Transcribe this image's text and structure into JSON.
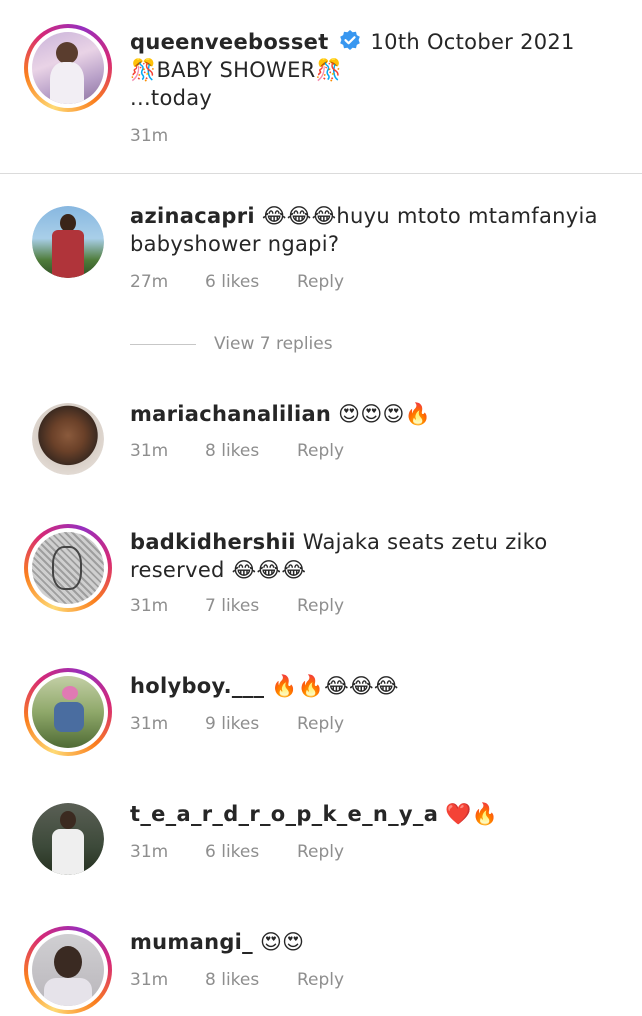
{
  "caption": {
    "username": "queenveebosset",
    "date": "10th October 2021",
    "line1": "🎊BABY SHOWER🎊",
    "line2": "...today",
    "time": "31m"
  },
  "comments": [
    {
      "username": "azinacapri",
      "text": "😂😂😂huyu mtoto mtamfanyia babyshower ngapi?",
      "time": "27m",
      "likes": "6 likes",
      "reply": "Reply"
    },
    {
      "username": "mariachanalilian",
      "text": "😍😍😍🔥",
      "time": "31m",
      "likes": "8 likes",
      "reply": "Reply"
    },
    {
      "username": "badkidhershii",
      "text": "Wajaka seats zetu ziko reserved 😂😂😂",
      "time": "31m",
      "likes": "7 likes",
      "reply": "Reply"
    },
    {
      "username": "holyboy.___",
      "text": "🔥🔥😂😂😂",
      "time": "31m",
      "likes": "9 likes",
      "reply": "Reply"
    },
    {
      "username": "t_e_a_r_d_r_o_p_k_e_n_y_a",
      "text": "❤️🔥",
      "time": "31m",
      "likes": "6 likes",
      "reply": "Reply"
    },
    {
      "username": "mumangi_",
      "text": "😍😍",
      "time": "31m",
      "likes": "8 likes",
      "reply": "Reply"
    }
  ],
  "view_replies": "View 7 replies",
  "colors": {
    "verified": "#3897f0",
    "meta": "#8e8e8e",
    "text": "#262626"
  }
}
